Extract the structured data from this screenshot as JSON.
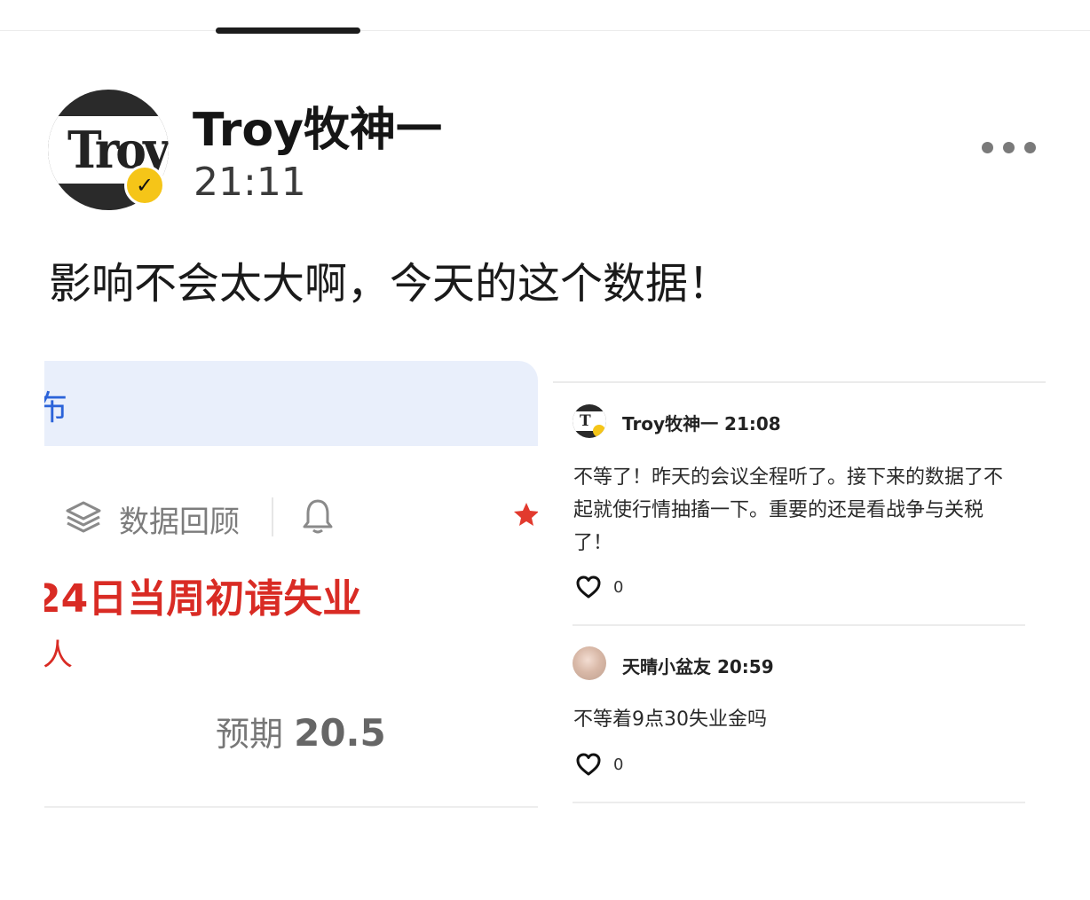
{
  "post": {
    "author": "Troy牧神一",
    "time": "21:11",
    "avatar_logo": "Troy",
    "text": "影响不会太大啊，今天的这个数据！",
    "menu_icon": "more-dots-icon"
  },
  "left_image": {
    "banner_text": "布",
    "review_label": "数据回顾",
    "headline": "24日当周初请失业",
    "sub": "人",
    "expect_label": "预期",
    "expect_value": "20.5",
    "icons": [
      "layers-icon",
      "bell-icon",
      "star-icon"
    ]
  },
  "right_image": {
    "comments": [
      {
        "name": "Troy牧神一 21:08",
        "text": "不等了！昨天的会议全程听了。接下来的数据了不起就使行情抽搐一下。重要的还是看战争与关税了！",
        "likes": "0"
      },
      {
        "name": "天晴小盆友 20:59",
        "text": "不等着9点30失业金吗",
        "likes": "0"
      }
    ]
  },
  "colors": {
    "accent_red": "#d92b24",
    "banner_blue": "#e9effb",
    "banner_text_blue": "#2b63d9",
    "verify_gold": "#f5c518"
  }
}
